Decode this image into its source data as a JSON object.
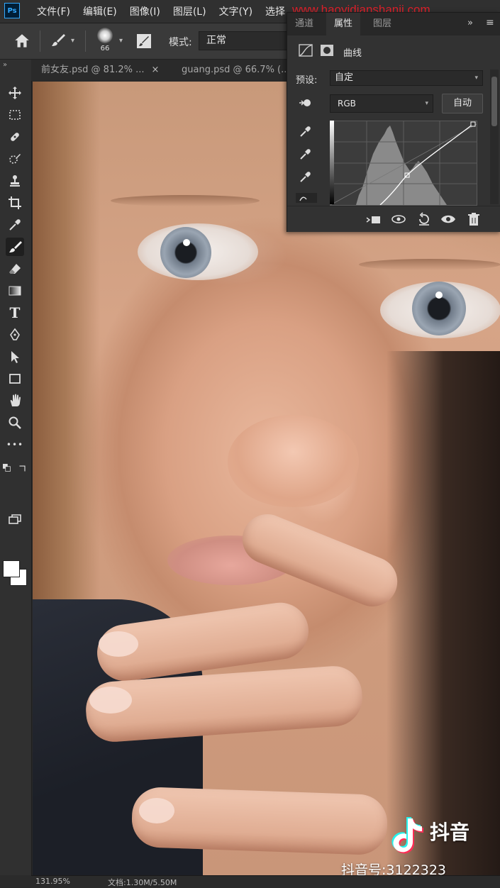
{
  "menubar": {
    "logo": "Ps",
    "items": [
      "文件(F)",
      "编辑(E)",
      "图像(I)",
      "图层(L)",
      "文字(Y)",
      "选择"
    ],
    "watermark": "www.haoyidianshanji.com"
  },
  "options": {
    "brush_size": "66",
    "mode_label": "模式:",
    "mode_value": "正常"
  },
  "tabs": [
    {
      "label": "前女友.psd @ 81.2% ...",
      "close": "×"
    },
    {
      "label": "guang.psd @ 66.7% (...",
      "close": ""
    }
  ],
  "tabs_collapse": "»",
  "tools": [
    "move-icon",
    "marquee-icon",
    "healing-icon",
    "quick-select-icon",
    "stamp-icon",
    "crop-icon",
    "eyedropper-icon",
    "brush-icon",
    "eraser-icon",
    "gradient-icon",
    "type-icon",
    "pen-icon",
    "path-select-icon",
    "rectangle-icon",
    "hand-icon",
    "zoom-icon",
    "more-icon"
  ],
  "type_tool_glyph": "T",
  "more_tool_glyph": "•••",
  "swatches": {
    "foreground": "#ffffff",
    "background": "#ffffff"
  },
  "panel": {
    "tabs": [
      "通道",
      "属性",
      "图层"
    ],
    "active_tab": "属性",
    "collapse": "»",
    "title": "曲线",
    "preset_label": "预设:",
    "preset_value": "自定",
    "channel_value": "RGB",
    "auto_label": "自动"
  },
  "status": {
    "zoom": "131.95%",
    "doc": "文档:1.30M/5.50M"
  },
  "overlay": {
    "tiktok_brand": "抖音",
    "tiktok_id": "抖音号:3122323"
  }
}
